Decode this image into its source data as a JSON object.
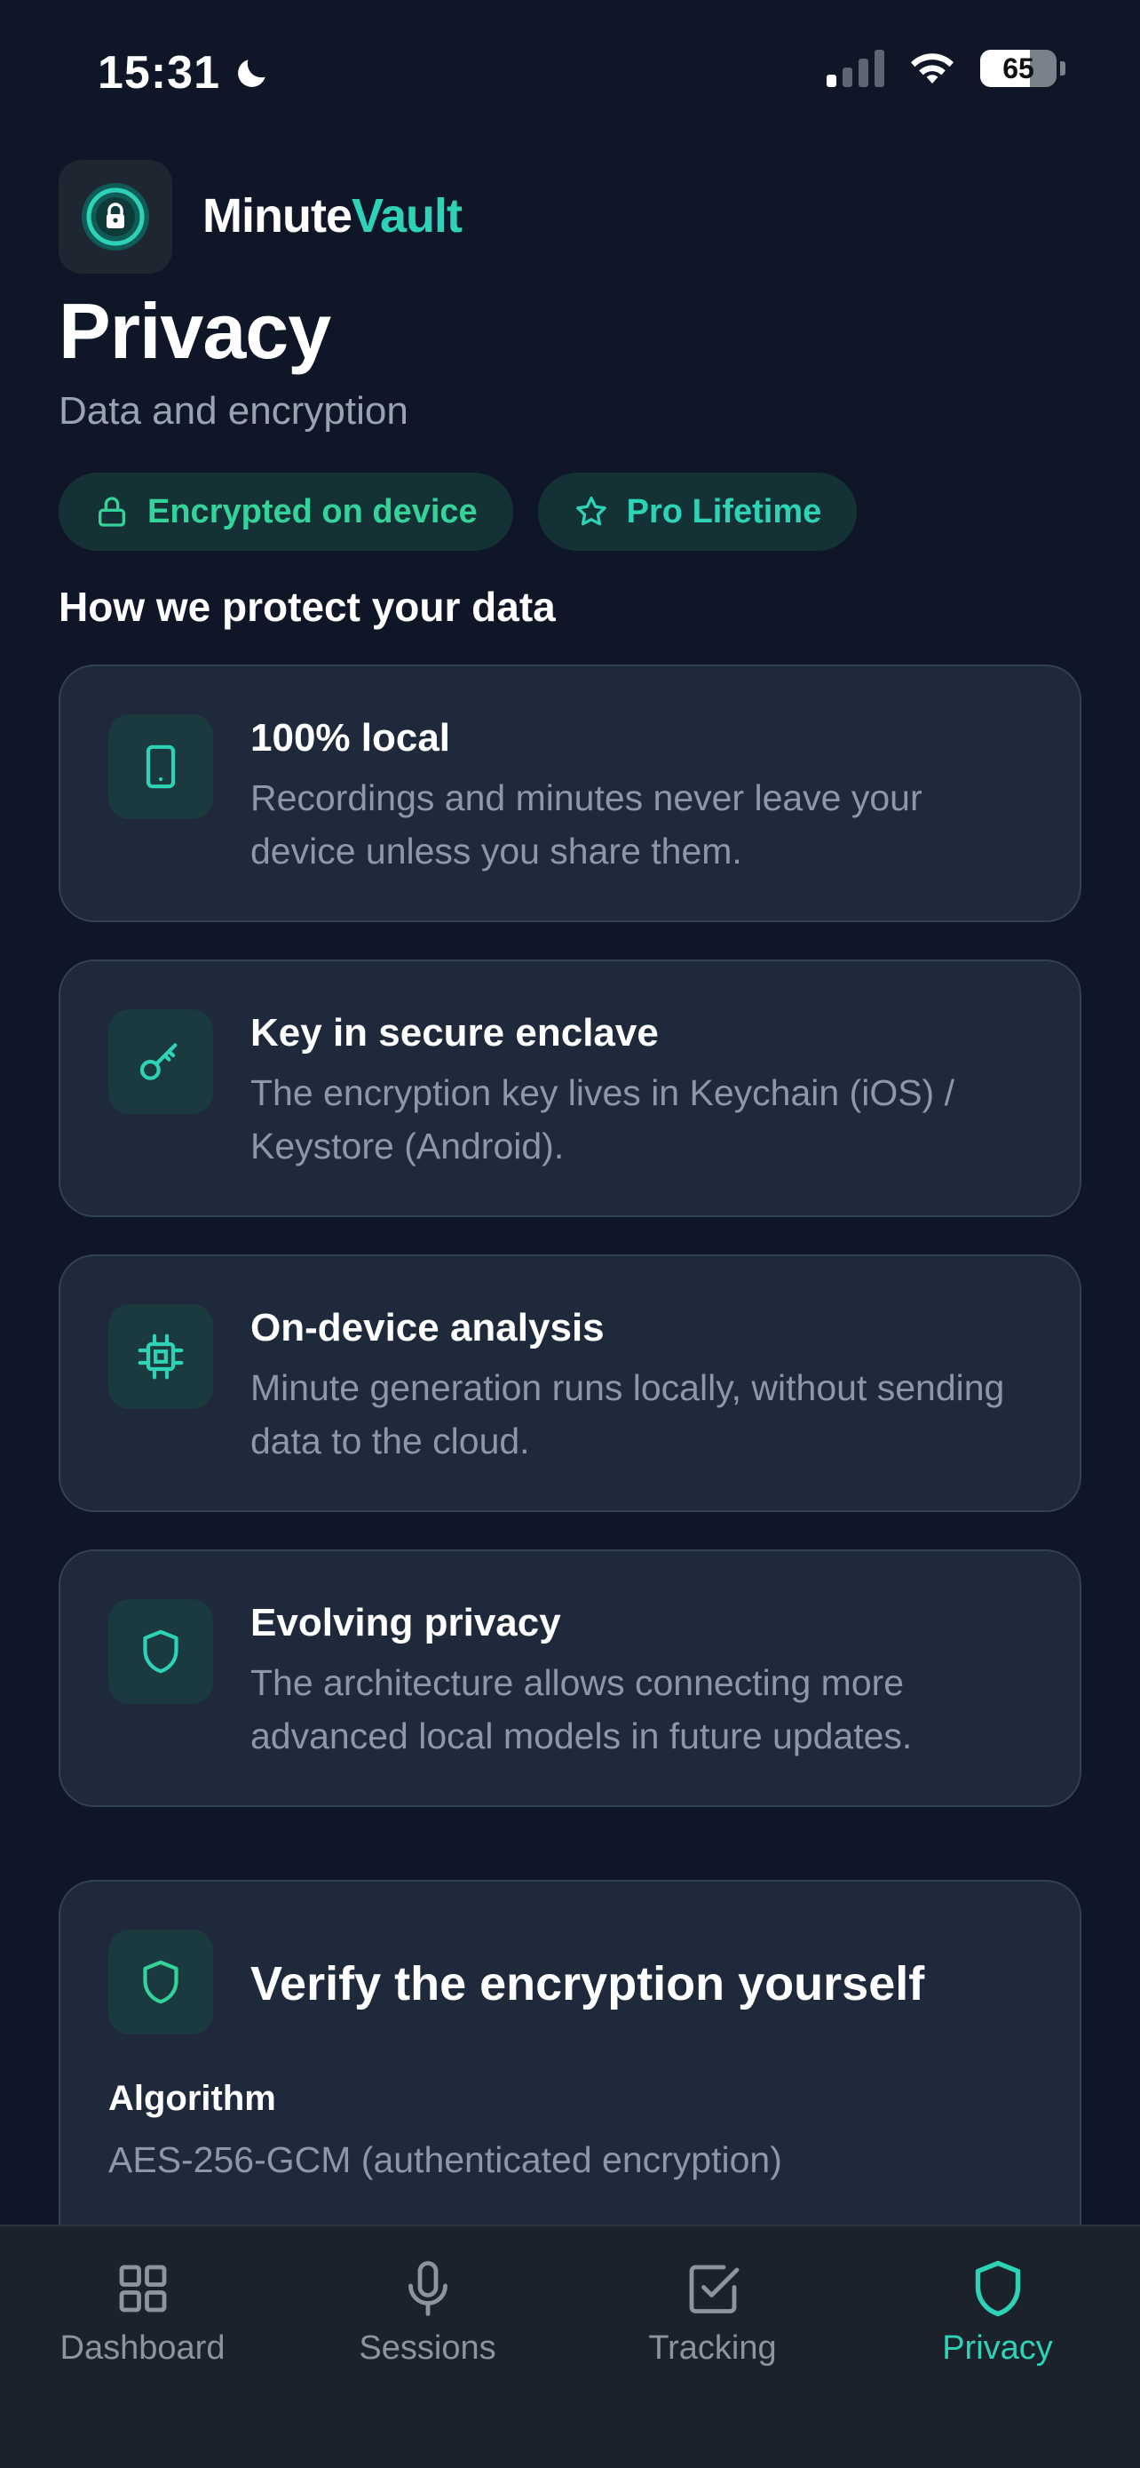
{
  "status_bar": {
    "time": "15:31",
    "battery_percent": "65"
  },
  "app": {
    "brand_part1": "Minute",
    "brand_part2": "Vault",
    "accent_color": "#2ed3b7"
  },
  "page": {
    "title": "Privacy",
    "subtitle": "Data and encryption"
  },
  "badges": [
    {
      "label": "Encrypted on device",
      "icon": "lock-icon",
      "color": "#34d399"
    },
    {
      "label": "Pro Lifetime",
      "icon": "star-icon",
      "color": "#2ed3b7"
    }
  ],
  "section": {
    "title": "How we protect your data"
  },
  "features": [
    {
      "title": "100% local",
      "description": "Recordings and minutes never leave your device unless you share them.",
      "icon": "phone-icon"
    },
    {
      "title": "Key in secure enclave",
      "description": "The encryption key lives in Keychain (iOS) / Keystore (Android).",
      "icon": "key-icon"
    },
    {
      "title": "On-device analysis",
      "description": "Minute generation runs locally, without sending data to the cloud.",
      "icon": "chip-icon"
    },
    {
      "title": "Evolving privacy",
      "description": "The architecture allows connecting more advanced local models in future updates.",
      "icon": "shield-icon"
    }
  ],
  "verify": {
    "title": "Verify the encryption yourself",
    "algorithm_label": "Algorithm",
    "algorithm_value": "AES-256-GCM (authenticated encryption)",
    "icon": "shield-icon"
  },
  "tabs": [
    {
      "label": "Dashboard",
      "icon": "grid-icon",
      "active": false
    },
    {
      "label": "Sessions",
      "icon": "microphone-icon",
      "active": false
    },
    {
      "label": "Tracking",
      "icon": "checkbox-icon",
      "active": false
    },
    {
      "label": "Privacy",
      "icon": "shield-icon",
      "active": true
    }
  ]
}
